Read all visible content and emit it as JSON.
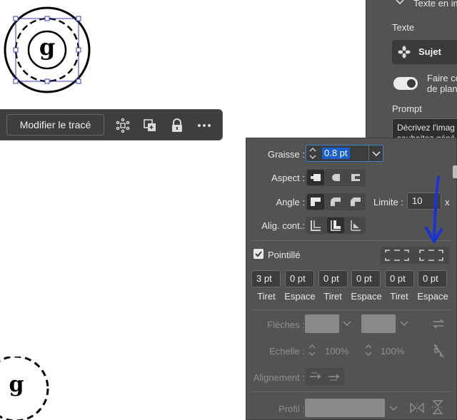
{
  "toolbar": {
    "modify_label": "Modifier le tracé",
    "icons": [
      "transform-icon",
      "arrange-icon",
      "lock-icon",
      "more-icon"
    ]
  },
  "canvas": {
    "glyph_top": "g",
    "glyph_bottom": "g"
  },
  "properties_panel": {
    "section_title": "Texte en im",
    "texte_label": "Texte",
    "sujet_label": "Sujet",
    "toggle_line1": "Faire co",
    "toggle_line2": "de plan",
    "prompt_label": "Prompt",
    "prompt_line1": "Décrivez l'imag",
    "prompt_line2": "souhaitez géné"
  },
  "stroke_panel": {
    "graisse_label": "Graisse :",
    "graisse_value": "0.8 pt",
    "aspect_label": "Aspect :",
    "angle_label": "Angle :",
    "limite_label": "Limite :",
    "limite_value": "10",
    "limite_unit": "x",
    "align_label": "Alig. cont.:",
    "pointille_label": "Pointillé",
    "pointille_checked": true,
    "dash_values": [
      "3 pt",
      "0 pt",
      "0 pt",
      "0 pt",
      "0 pt",
      "0 pt"
    ],
    "dash_labels": [
      "Tiret",
      "Espace",
      "Tiret",
      "Espace",
      "Tiret",
      "Espace"
    ],
    "fleches_label": "Flèches :",
    "echelle_label": "Echelle :",
    "echelle_value_1": "100%",
    "echelle_value_2": "100%",
    "alignement_label": "Alignement :",
    "profil_label": "Profil :"
  },
  "colors": {
    "panel_bg": "#535353",
    "selection": "#1a5fd0",
    "annotation_arrow": "#1a33d6",
    "bounding_box": "#3b3bb0"
  }
}
